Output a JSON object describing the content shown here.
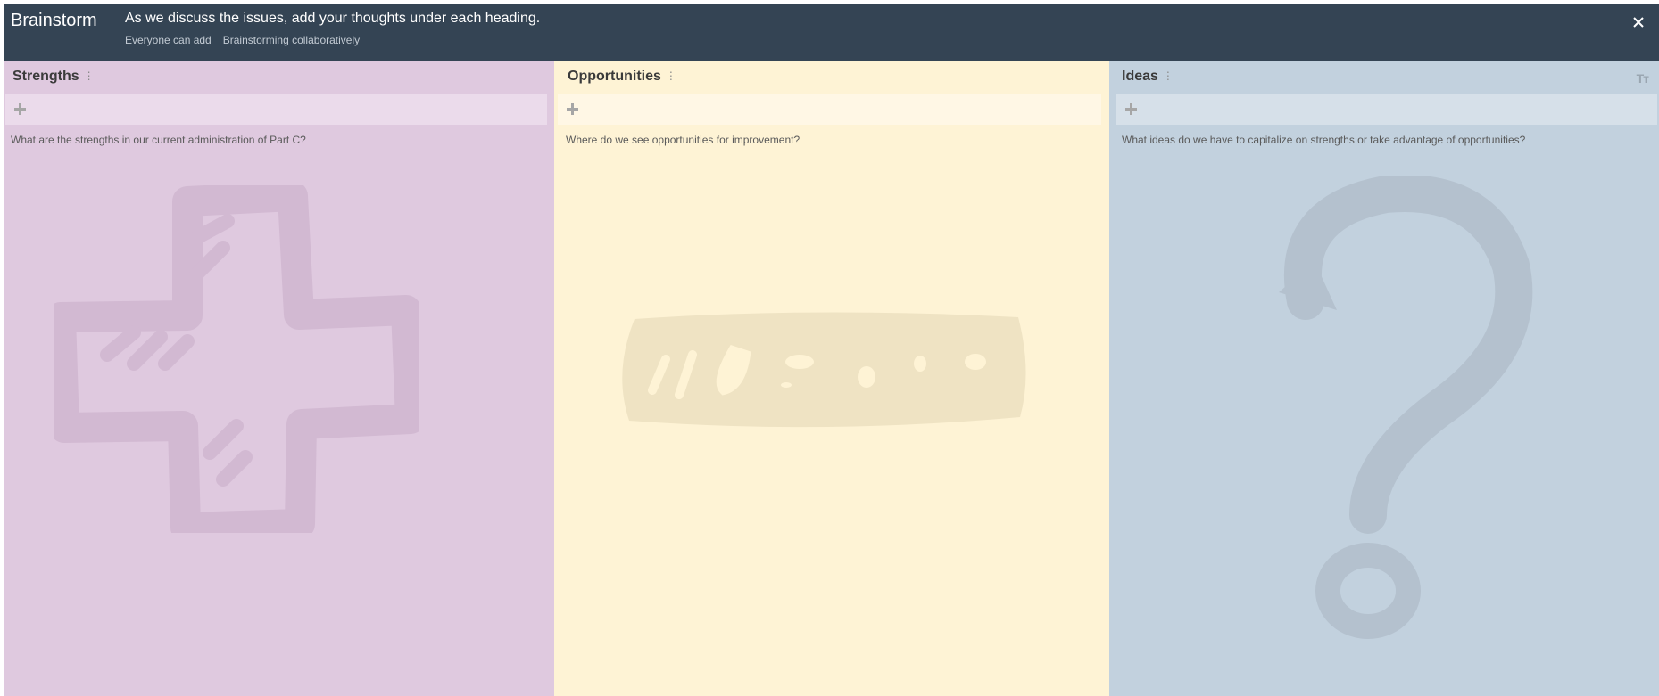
{
  "header": {
    "title": "Brainstorm",
    "instructions": "As we discuss the issues, add your thoughts under each heading.",
    "permission_text": "Everyone can add",
    "mode_text": "Brainstorming collaboratively",
    "close_icon": "close-icon"
  },
  "columns": [
    {
      "title": "Strengths",
      "menu_glyph": "⋮",
      "prompt": "What are the strengths in our current administration of Part C?",
      "background": "#dfc9df",
      "watermark_icon": "plus-watermark-icon"
    },
    {
      "title": "Opportunities",
      "menu_glyph": "⋮",
      "prompt": "Where do we see opportunities for improvement?",
      "background": "#fef3d5",
      "watermark_icon": "minus-watermark-icon"
    },
    {
      "title": "Ideas",
      "menu_glyph": "⋮",
      "prompt": "What ideas do we have to capitalize on strengths or take advantage of opportunities?",
      "background": "#c2d1de",
      "watermark_icon": "question-mark-watermark-icon",
      "text_size_label": "Tт"
    }
  ],
  "colors": {
    "header_bg": "#344454",
    "header_text": "#ffffff",
    "header_subtext": "#c3cbd4"
  }
}
